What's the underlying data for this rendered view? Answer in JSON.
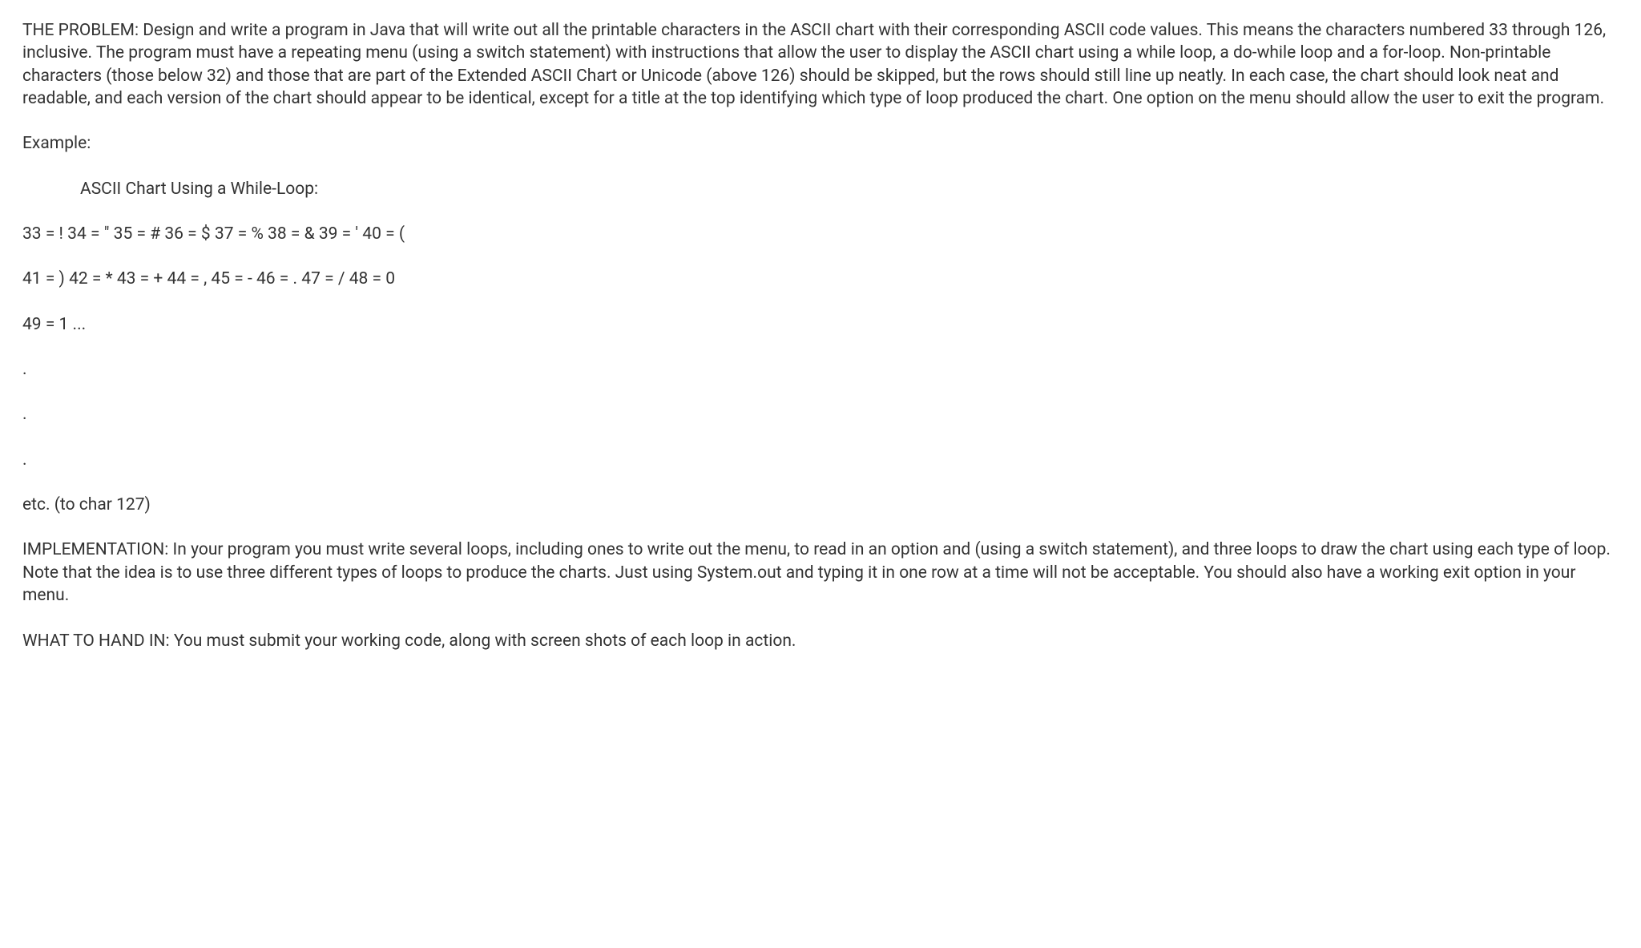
{
  "problem_paragraph": "THE PROBLEM: Design and write a program in Java that will write out all the printable characters in the ASCII chart with their corresponding ASCII code values.  This means the characters numbered 33 through 126, inclusive.  The program must have a repeating menu (using a switch statement) with instructions that allow the user to display the ASCII chart using a while loop, a do-while loop and a for-loop.  Non-printable characters (those below 32) and those that are part of the Extended ASCII Chart or Unicode (above 126) should be skipped, but the rows should still line up neatly.  In each case, the chart should look neat and readable, and each version of the chart should appear to be identical, except for a title at the top identifying which type of loop produced the chart.  One option on the menu should allow the user to exit the program.",
  "example_label": "Example:",
  "chart_title": "ASCII Chart Using a While-Loop:",
  "chart_row1": "33 = !  34 = \"   35 = #  36 = $  37 = %  38 = &  39 = ' 40 = (",
  "chart_row2": "41 = )  42 = *  43 = +  44 = ,   45 = -  46 = .   47 = / 48 = 0",
  "chart_row3": "49 = 1  ...",
  "dot1": ".",
  "dot2": ".",
  "dot3": ".",
  "etc_text": "etc. (to char 127)",
  "implementation_paragraph": "IMPLEMENTATION: In your program you must write several loops, including ones to write out the menu, to read in an option and (using a switch statement), and three loops to draw the chart using each type of loop.  Note that the idea is to use three different types of loops to produce the charts.  Just using System.out and typing it in one row at a time will not be acceptable.  You should also have a working exit option in your menu.",
  "handin_paragraph": "WHAT TO HAND IN: You must submit your working code, along with screen shots of each loop in action."
}
